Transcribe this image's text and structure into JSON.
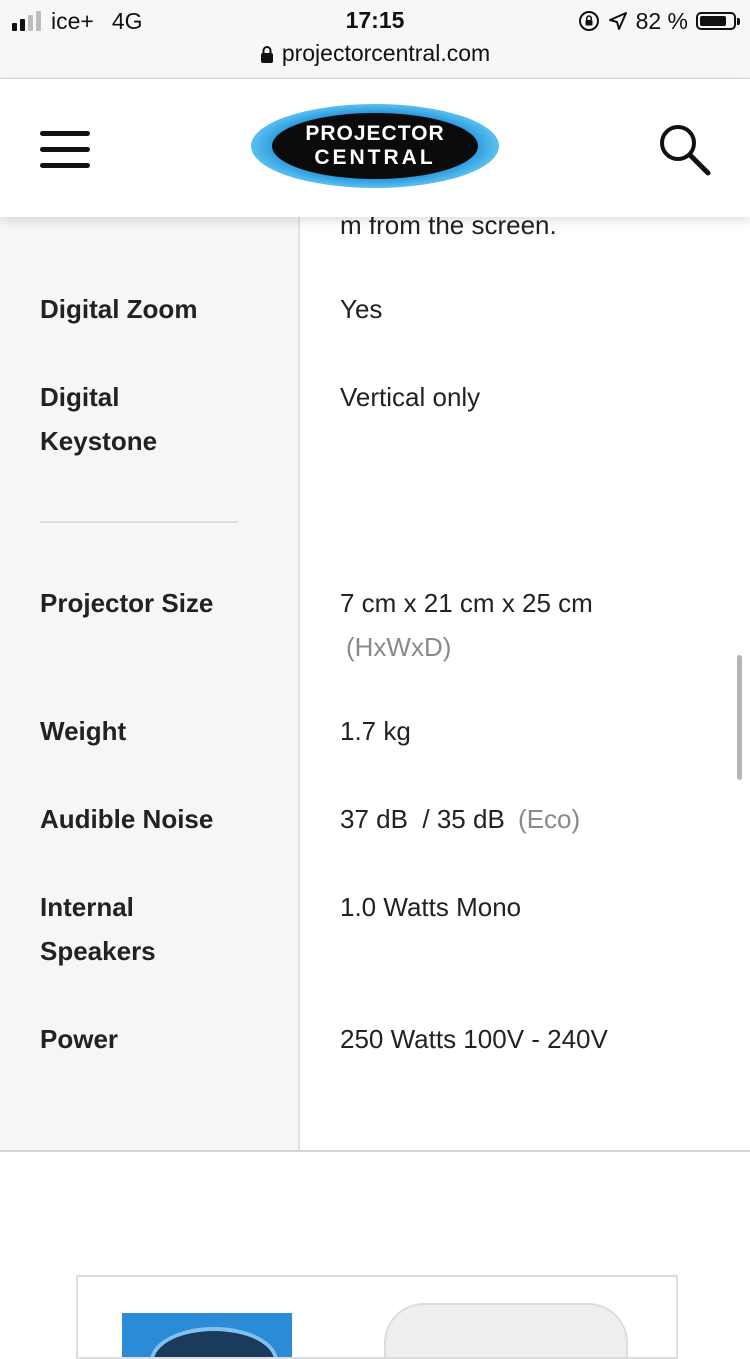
{
  "status_bar": {
    "carrier": "ice+",
    "network": "4G",
    "time": "17:15",
    "battery_percent": "82 %",
    "battery_level": 0.82,
    "signal_bars_filled": 2,
    "signal_bars_total": 4
  },
  "browser": {
    "url": "projectorcentral.com"
  },
  "header": {
    "logo_line1": "PROJECTOR",
    "logo_line2": "CENTRAL"
  },
  "specs": {
    "partial_value": "m from the screen.",
    "rows": [
      {
        "label": "Digital Zoom",
        "value": "Yes"
      },
      {
        "label_line1": "Digital",
        "label_line2": "Keystone",
        "value": "Vertical only"
      },
      {
        "label": "Projector Size",
        "value": "7 cm x 21 cm x 25 cm",
        "note": "(HxWxD)"
      },
      {
        "label": "Weight",
        "value": "1.7 kg"
      },
      {
        "label": "Audible Noise",
        "value": "37 dB  / 35 dB",
        "note": "(Eco)"
      },
      {
        "label_line1": "Internal",
        "label_line2": "Speakers",
        "value": "1.0 Watts Mono"
      },
      {
        "label": "Power",
        "value": "250 Watts 100V - 240V"
      }
    ]
  },
  "colors": {
    "logo_blue": "#2fa6e8",
    "label_bg": "#f6f6f6",
    "muted_text": "#8a8a8a"
  },
  "icons": {
    "menu": "hamburger-icon",
    "search": "search-icon",
    "lock": "lock-icon",
    "rotation_lock": "rotation-lock-icon",
    "location": "location-arrow-icon"
  }
}
